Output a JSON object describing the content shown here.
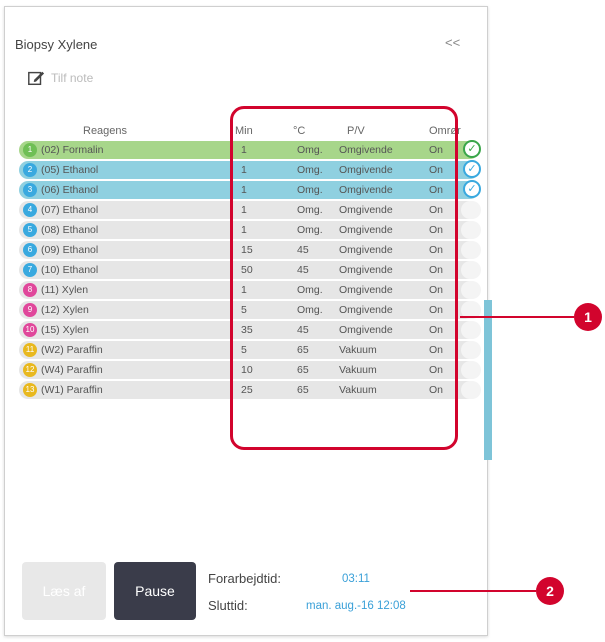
{
  "panel": {
    "title": "Biopsy Xylene",
    "collapse_label": "<<",
    "note_label": "Tilf note"
  },
  "table": {
    "headers": {
      "reagens": "Reagens",
      "min": "Min",
      "temp": "°C",
      "pv": "P/V",
      "omror": "Omrør"
    },
    "rows": [
      {
        "badge": "1",
        "badge_color": "#6fbf55",
        "name": "(02) Formalin",
        "min": "1",
        "temp": "Omg.",
        "pv": "Omgivende",
        "omror": "On",
        "state": "green"
      },
      {
        "badge": "2",
        "badge_color": "#39a9df",
        "name": "(05) Ethanol",
        "min": "1",
        "temp": "Omg.",
        "pv": "Omgivende",
        "omror": "On",
        "state": "blue"
      },
      {
        "badge": "3",
        "badge_color": "#39a9df",
        "name": "(06) Ethanol",
        "min": "1",
        "temp": "Omg.",
        "pv": "Omgivende",
        "omror": "On",
        "state": "blue"
      },
      {
        "badge": "4",
        "badge_color": "#39a9df",
        "name": "(07) Ethanol",
        "min": "1",
        "temp": "Omg.",
        "pv": "Omgivende",
        "omror": "On",
        "state": ""
      },
      {
        "badge": "5",
        "badge_color": "#39a9df",
        "name": "(08) Ethanol",
        "min": "1",
        "temp": "Omg.",
        "pv": "Omgivende",
        "omror": "On",
        "state": ""
      },
      {
        "badge": "6",
        "badge_color": "#39a9df",
        "name": "(09) Ethanol",
        "min": "15",
        "temp": "45",
        "pv": "Omgivende",
        "omror": "On",
        "state": ""
      },
      {
        "badge": "7",
        "badge_color": "#39a9df",
        "name": "(10) Ethanol",
        "min": "50",
        "temp": "45",
        "pv": "Omgivende",
        "omror": "On",
        "state": ""
      },
      {
        "badge": "8",
        "badge_color": "#e0479b",
        "name": "(11) Xylen",
        "min": "1",
        "temp": "Omg.",
        "pv": "Omgivende",
        "omror": "On",
        "state": ""
      },
      {
        "badge": "9",
        "badge_color": "#e0479b",
        "name": "(12) Xylen",
        "min": "5",
        "temp": "Omg.",
        "pv": "Omgivende",
        "omror": "On",
        "state": ""
      },
      {
        "badge": "10",
        "badge_color": "#e0479b",
        "name": "(15) Xylen",
        "min": "35",
        "temp": "45",
        "pv": "Omgivende",
        "omror": "On",
        "state": ""
      },
      {
        "badge": "11",
        "badge_color": "#e8b81e",
        "name": "(W2) Paraffin",
        "min": "5",
        "temp": "65",
        "pv": "Vakuum",
        "omror": "On",
        "state": ""
      },
      {
        "badge": "12",
        "badge_color": "#e8b81e",
        "name": "(W4) Paraffin",
        "min": "10",
        "temp": "65",
        "pv": "Vakuum",
        "omror": "On",
        "state": ""
      },
      {
        "badge": "13",
        "badge_color": "#e8b81e",
        "name": "(W1) Paraffin",
        "min": "25",
        "temp": "65",
        "pv": "Vakuum",
        "omror": "On",
        "state": ""
      }
    ]
  },
  "footer": {
    "laes_label": "Læs af",
    "pause_label": "Pause",
    "forarbejd_label": "Forarbejdtid:",
    "forarbejd_value": "03:11",
    "slut_label": "Sluttid:",
    "slut_value": "man. aug.-16 12:08"
  },
  "callouts": {
    "one": "1",
    "two": "2"
  },
  "colors": {
    "highlight": "#d2042d",
    "green_row": "#a7d68a",
    "blue_row": "#8fd0e0"
  }
}
